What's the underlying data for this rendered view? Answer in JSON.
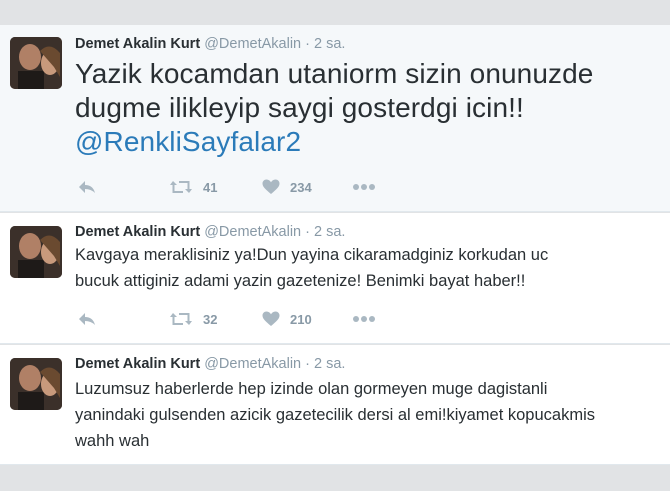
{
  "tweets": [
    {
      "name": "Demet Akalin Kurt",
      "handle": "@DemetAkalin",
      "separator": "·",
      "time": "2 sa.",
      "text_lines": [
        "Yazik kocamdan utaniorm sizin onunuzde",
        "dugme ilikleyip saygi gosterdgi icin!!"
      ],
      "mention": "@RenkliSayfalar2",
      "retweets": "41",
      "likes": "234"
    },
    {
      "name": "Demet Akalin Kurt",
      "handle": "@DemetAkalin",
      "separator": "·",
      "time": "2 sa.",
      "text_lines": [
        "Kavgaya meraklisiniz ya!Dun yayina cikaramadginiz korkudan  uc",
        "bucuk attiginiz adami yazin gazetenize! Benimki bayat haber!!"
      ],
      "retweets": "32",
      "likes": "210"
    },
    {
      "name": "Demet Akalin Kurt",
      "handle": "@DemetAkalin",
      "separator": "·",
      "time": "2 sa.",
      "text_lines": [
        "Luzumsuz haberlerde hep izinde olan gormeyen muge dagistanli",
        "yanindaki gulsenden azicik gazetecilik dersi al emi!kiyamet kopucakmis",
        "wahh wah"
      ]
    }
  ],
  "colors": {
    "link": "#2b7bb9",
    "meta": "#8899a6",
    "icon": "#aab8c2"
  },
  "icons": {
    "reply": "reply-icon",
    "retweet": "retweet-icon",
    "like": "heart-icon",
    "more": "more-icon"
  }
}
